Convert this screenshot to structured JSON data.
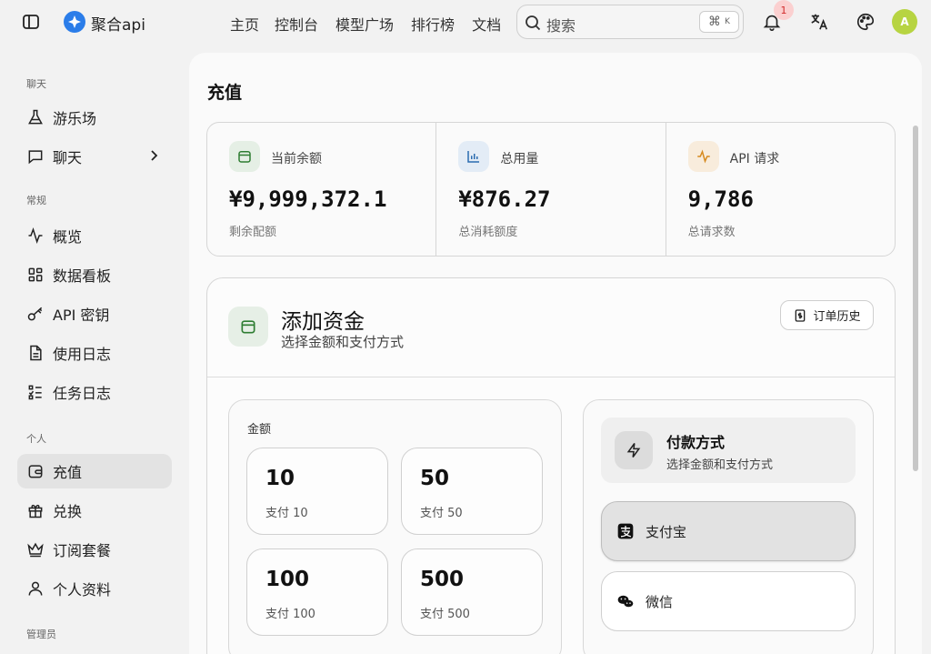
{
  "header": {
    "brand": "聚合api",
    "nav": [
      "主页",
      "控制台",
      "模型广场",
      "排行榜",
      "文档"
    ],
    "search_placeholder": "搜索",
    "search_shortcut_symbol": "⌘",
    "search_shortcut_key": "K",
    "notification_count": "1",
    "avatar_initial": "A"
  },
  "sidebar": {
    "section_chat": "聊天",
    "section_general": "常规",
    "section_personal": "个人",
    "section_admin": "管理员",
    "items": [
      {
        "label": "游乐场",
        "icon": "flask-icon"
      },
      {
        "label": "聊天",
        "icon": "chat-icon"
      },
      {
        "label": "概览",
        "icon": "activity-icon"
      },
      {
        "label": "数据看板",
        "icon": "dashboard-icon"
      },
      {
        "label": "API 密钥",
        "icon": "key-icon"
      },
      {
        "label": "使用日志",
        "icon": "document-icon"
      },
      {
        "label": "任务日志",
        "icon": "list-check-icon"
      },
      {
        "label": "充值",
        "icon": "wallet-icon"
      },
      {
        "label": "兑换",
        "icon": "gift-icon"
      },
      {
        "label": "订阅套餐",
        "icon": "crown-icon"
      },
      {
        "label": "个人资料",
        "icon": "user-icon"
      }
    ],
    "active_item": "充值"
  },
  "page": {
    "title": "充值",
    "stats": [
      {
        "label": "当前余额",
        "value": "¥9,999,372.1",
        "sub": "剩余配额",
        "icon": "wallet-icon",
        "color": "#2e7d32",
        "bg": "#e5efe5"
      },
      {
        "label": "总用量",
        "value": "¥876.27",
        "sub": "总消耗额度",
        "icon": "bar-chart-icon",
        "color": "#2b6cb0",
        "bg": "#e3ecf6"
      },
      {
        "label": "API 请求",
        "value": "9,786",
        "sub": "总请求数",
        "icon": "pulse-icon",
        "color": "#d68a1f",
        "bg": "#f8ecdc"
      }
    ],
    "add_funds": {
      "title": "添加资金",
      "subtitle": "选择金额和支付方式",
      "history_button": "订单历史",
      "amount_label": "金额",
      "amounts": [
        {
          "value": "10",
          "pay": "支付 10"
        },
        {
          "value": "50",
          "pay": "支付 50"
        },
        {
          "value": "100",
          "pay": "支付 100"
        },
        {
          "value": "500",
          "pay": "支付 500"
        }
      ],
      "payment": {
        "title": "付款方式",
        "subtitle": "选择金额和支付方式",
        "methods": [
          {
            "label": "支付宝",
            "selected": true
          },
          {
            "label": "微信",
            "selected": false
          }
        ]
      }
    }
  }
}
